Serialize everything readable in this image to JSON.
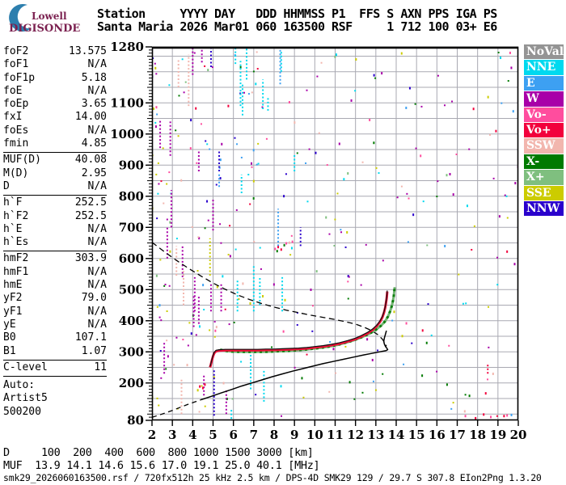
{
  "logo": {
    "line1": "Lowell",
    "line2": "DIGISONDE",
    "crescent_color": "#2d7fae"
  },
  "header": {
    "line1": "Station     YYYY DAY   DDD HHMMSS P1  FFS S AXN PPS IGA PS",
    "line2": "Santa Maria 2026 Mar01 060 163500 RSF     1 712 100 03+ E6"
  },
  "params": {
    "groups": [
      {
        "rows": [
          {
            "label": "foF2",
            "value": "13.575"
          },
          {
            "label": "foF1",
            "value": "N/A"
          },
          {
            "label": "foF1p",
            "value": "5.18"
          },
          {
            "label": "foE",
            "value": "N/A"
          },
          {
            "label": "foEp",
            "value": "3.65"
          },
          {
            "label": "fxI",
            "value": "14.00"
          },
          {
            "label": "foEs",
            "value": "N/A"
          },
          {
            "label": "fmin",
            "value": "4.85"
          }
        ]
      },
      {
        "rows": [
          {
            "label": "MUF(D)",
            "value": "40.08"
          },
          {
            "label": "M(D)",
            "value": "2.95"
          },
          {
            "label": "D",
            "value": "N/A"
          }
        ]
      },
      {
        "rows": [
          {
            "label": "h`F",
            "value": "252.5"
          },
          {
            "label": "h`F2",
            "value": "252.5"
          },
          {
            "label": "h`E",
            "value": "N/A"
          },
          {
            "label": "h`Es",
            "value": "N/A"
          }
        ]
      },
      {
        "rows": [
          {
            "label": "hmF2",
            "value": "303.9"
          },
          {
            "label": "hmF1",
            "value": "N/A"
          },
          {
            "label": "hmE",
            "value": "N/A"
          },
          {
            "label": "yF2",
            "value": "79.0"
          },
          {
            "label": "yF1",
            "value": "N/A"
          },
          {
            "label": "yE",
            "value": "N/A"
          },
          {
            "label": "B0",
            "value": "107.1"
          },
          {
            "label": "B1",
            "value": "1.07"
          }
        ]
      },
      {
        "rows": [
          {
            "label": "C-level",
            "value": "11"
          }
        ]
      }
    ],
    "auto_lines": [
      "Auto:",
      "Artist5",
      "500200"
    ]
  },
  "legend": {
    "items": [
      {
        "label": "NoVal",
        "color": "#949494"
      },
      {
        "label": "NNE",
        "color": "#00d9ef"
      },
      {
        "label": "E",
        "color": "#3da0f2"
      },
      {
        "label": "W",
        "color": "#a800a8"
      },
      {
        "label": "Vo-",
        "color": "#ff4d9e"
      },
      {
        "label": "Vo+",
        "color": "#f2003c"
      },
      {
        "label": "SSW",
        "color": "#f2b6ae"
      },
      {
        "label": "X-",
        "color": "#007a00"
      },
      {
        "label": "X+",
        "color": "#7fbf7f"
      },
      {
        "label": "SSE",
        "color": "#cccc00"
      },
      {
        "label": "NNW",
        "color": "#2a00cc"
      }
    ]
  },
  "chart_data": {
    "type": "scatter",
    "x_range": [
      2,
      20
    ],
    "y_range": [
      80,
      1280
    ],
    "x_ticks": [
      2,
      3,
      4,
      5,
      6,
      7,
      8,
      9,
      10,
      11,
      12,
      13,
      14,
      15,
      16,
      17,
      18,
      19,
      20
    ],
    "y_tick_labels": [
      80,
      200,
      300,
      400,
      500,
      600,
      700,
      800,
      900,
      1000,
      1100,
      1280
    ],
    "grid": {
      "x_step": 1,
      "y_step": 50,
      "color": "#a9a9b2"
    },
    "palette": {
      "NoVal": "#949494",
      "NNE": "#00d9ef",
      "E": "#3da0f2",
      "W": "#a800a8",
      "Vo-": "#ff4d9e",
      "Vo+": "#f2003c",
      "SSW": "#f2b6ae",
      "X-": "#007a00",
      "X+": "#7fbf7f",
      "SSE": "#cccc00",
      "NNW": "#2a00cc"
    },
    "trace_colors": {
      "o_trace": "#ee1038",
      "o_fit": "#101010",
      "x_trace_light": "#74b674",
      "x_trace_dark": "#0f7d0f",
      "profile": "#000000"
    },
    "traces": {
      "o_trace": [
        [
          4.85,
          250
        ],
        [
          4.88,
          256
        ],
        [
          4.91,
          264
        ],
        [
          4.95,
          274
        ],
        [
          5.0,
          286
        ],
        [
          5.06,
          296
        ],
        [
          5.15,
          302
        ],
        [
          5.3,
          304
        ],
        [
          5.6,
          305
        ],
        [
          6.0,
          305
        ],
        [
          6.4,
          305
        ],
        [
          6.8,
          305
        ],
        [
          7.2,
          305
        ],
        [
          7.6,
          306
        ],
        [
          8.0,
          306
        ],
        [
          8.4,
          307
        ],
        [
          8.8,
          308
        ],
        [
          9.2,
          309
        ],
        [
          9.6,
          311
        ],
        [
          10.0,
          314
        ],
        [
          10.4,
          317
        ],
        [
          10.8,
          321
        ],
        [
          11.2,
          326
        ],
        [
          11.6,
          333
        ],
        [
          12.0,
          341
        ],
        [
          12.3,
          350
        ],
        [
          12.6,
          360
        ],
        [
          12.85,
          371
        ],
        [
          13.05,
          383
        ],
        [
          13.2,
          396
        ],
        [
          13.32,
          411
        ],
        [
          13.4,
          426
        ],
        [
          13.46,
          442
        ],
        [
          13.5,
          458
        ],
        [
          13.53,
          472
        ],
        [
          13.55,
          486
        ],
        [
          13.56,
          494
        ]
      ],
      "x_trace": [
        [
          5.35,
          307
        ],
        [
          5.6,
          303
        ],
        [
          5.9,
          301
        ],
        [
          6.3,
          300
        ],
        [
          6.7,
          300
        ],
        [
          7.1,
          300
        ],
        [
          7.5,
          300
        ],
        [
          7.9,
          301
        ],
        [
          8.3,
          302
        ],
        [
          8.7,
          303
        ],
        [
          9.1,
          305
        ],
        [
          9.5,
          307
        ],
        [
          9.9,
          310
        ],
        [
          10.3,
          313
        ],
        [
          10.7,
          317
        ],
        [
          11.1,
          322
        ],
        [
          11.5,
          329
        ],
        [
          11.9,
          337
        ],
        [
          12.3,
          347
        ],
        [
          12.7,
          359
        ],
        [
          13.0,
          371
        ],
        [
          13.25,
          384
        ],
        [
          13.45,
          398
        ],
        [
          13.6,
          414
        ],
        [
          13.7,
          430
        ],
        [
          13.78,
          447
        ],
        [
          13.84,
          464
        ],
        [
          13.88,
          480
        ],
        [
          13.91,
          497
        ],
        [
          13.93,
          508
        ]
      ],
      "profile_dashed": [
        [
          2.0,
          90
        ],
        [
          2.35,
          97
        ],
        [
          2.7,
          105
        ],
        [
          3.05,
          113
        ],
        [
          3.4,
          122
        ],
        [
          3.75,
          131
        ],
        [
          4.1,
          139
        ],
        [
          4.4,
          146
        ]
      ],
      "profile_solid": [
        [
          4.4,
          146
        ],
        [
          4.9,
          157
        ],
        [
          5.4,
          168
        ],
        [
          5.9,
          179
        ],
        [
          6.4,
          190
        ],
        [
          6.9,
          200
        ],
        [
          7.4,
          210
        ],
        [
          7.9,
          220
        ],
        [
          8.4,
          229
        ],
        [
          8.9,
          238
        ],
        [
          9.4,
          246
        ],
        [
          9.9,
          254
        ],
        [
          10.4,
          262
        ],
        [
          10.9,
          269
        ],
        [
          11.4,
          276
        ],
        [
          11.9,
          283
        ],
        [
          12.4,
          290
        ],
        [
          12.8,
          295
        ],
        [
          13.1,
          299
        ],
        [
          13.35,
          302
        ],
        [
          13.5,
          304
        ],
        [
          13.58,
          307
        ],
        [
          13.55,
          311
        ],
        [
          13.48,
          317
        ],
        [
          13.42,
          325
        ],
        [
          13.39,
          334
        ],
        [
          13.42,
          345
        ],
        [
          13.47,
          357
        ],
        [
          13.52,
          368
        ]
      ],
      "muf_dashed": [
        [
          2.0,
          652
        ],
        [
          2.6,
          622
        ],
        [
          3.2,
          594
        ],
        [
          3.8,
          568
        ],
        [
          4.4,
          544
        ],
        [
          5.0,
          521
        ],
        [
          5.6,
          501
        ],
        [
          6.2,
          483
        ],
        [
          6.8,
          468
        ],
        [
          7.4,
          455
        ],
        [
          8.0,
          444
        ],
        [
          8.6,
          434
        ],
        [
          9.2,
          426
        ],
        [
          9.8,
          418
        ],
        [
          10.4,
          411
        ],
        [
          11.0,
          404
        ],
        [
          11.5,
          397
        ],
        [
          12.0,
          389
        ],
        [
          12.4,
          380
        ],
        [
          12.8,
          368
        ],
        [
          13.1,
          355
        ],
        [
          13.3,
          342
        ],
        [
          13.45,
          329
        ],
        [
          13.52,
          318
        ]
      ]
    },
    "streaks": [
      {
        "f": 2.4,
        "h1": 955,
        "h2": 1045,
        "c": "W"
      },
      {
        "f": 2.6,
        "h1": 230,
        "h2": 330,
        "c": "W"
      },
      {
        "f": 2.75,
        "h1": 600,
        "h2": 700,
        "c": "W"
      },
      {
        "f": 2.9,
        "h1": 930,
        "h2": 1040,
        "c": "W"
      },
      {
        "f": 2.95,
        "h1": 700,
        "h2": 820,
        "c": "W"
      },
      {
        "f": 3.2,
        "h1": 545,
        "h2": 640,
        "c": "SSW"
      },
      {
        "f": 3.3,
        "h1": 1150,
        "h2": 1240,
        "c": "SSW"
      },
      {
        "f": 3.45,
        "h1": 100,
        "h2": 215,
        "c": "SSW"
      },
      {
        "f": 3.5,
        "h1": 540,
        "h2": 640,
        "c": "W"
      },
      {
        "f": 3.55,
        "h1": 450,
        "h2": 560,
        "c": "SSW"
      },
      {
        "f": 3.8,
        "h1": 1090,
        "h2": 1255,
        "c": "SSW"
      },
      {
        "f": 4.0,
        "h1": 1190,
        "h2": 1278,
        "c": "W"
      },
      {
        "f": 4.05,
        "h1": 380,
        "h2": 480,
        "c": "W"
      },
      {
        "f": 4.1,
        "h1": 430,
        "h2": 540,
        "c": "W"
      },
      {
        "f": 4.3,
        "h1": 880,
        "h2": 950,
        "c": "W"
      },
      {
        "f": 4.3,
        "h1": 390,
        "h2": 480,
        "c": "W"
      },
      {
        "f": 4.45,
        "h1": 1230,
        "h2": 1278,
        "c": "W"
      },
      {
        "f": 4.55,
        "h1": 160,
        "h2": 230,
        "c": "W"
      },
      {
        "f": 4.85,
        "h1": 545,
        "h2": 665,
        "c": "SSE"
      },
      {
        "f": 4.9,
        "h1": 1215,
        "h2": 1278,
        "c": "NNW"
      },
      {
        "f": 4.9,
        "h1": 430,
        "h2": 520,
        "c": "W"
      },
      {
        "f": 5.0,
        "h1": 690,
        "h2": 790,
        "c": "W"
      },
      {
        "f": 5.05,
        "h1": 95,
        "h2": 245,
        "c": "NNW"
      },
      {
        "f": 5.3,
        "h1": 830,
        "h2": 875,
        "c": "E"
      },
      {
        "f": 5.3,
        "h1": 880,
        "h2": 945,
        "c": "NNW"
      },
      {
        "f": 5.4,
        "h1": 430,
        "h2": 520,
        "c": "W"
      },
      {
        "f": 5.65,
        "h1": 100,
        "h2": 180,
        "c": "W"
      },
      {
        "f": 5.9,
        "h1": 85,
        "h2": 115,
        "c": "NNE"
      },
      {
        "f": 6.1,
        "h1": 1225,
        "h2": 1278,
        "c": "NNE"
      },
      {
        "f": 6.2,
        "h1": 430,
        "h2": 530,
        "c": "NNE"
      },
      {
        "f": 6.35,
        "h1": 1090,
        "h2": 1235,
        "c": "NNE"
      },
      {
        "f": 6.45,
        "h1": 1060,
        "h2": 1160,
        "c": "NNE"
      },
      {
        "f": 6.65,
        "h1": 1175,
        "h2": 1275,
        "c": "NNE"
      },
      {
        "f": 6.85,
        "h1": 180,
        "h2": 290,
        "c": "NNE"
      },
      {
        "f": 7.0,
        "h1": 430,
        "h2": 575,
        "c": "NNE"
      },
      {
        "f": 7.3,
        "h1": 450,
        "h2": 540,
        "c": "NNE"
      },
      {
        "f": 7.45,
        "h1": 1080,
        "h2": 1175,
        "c": "NNE"
      },
      {
        "f": 7.5,
        "h1": 140,
        "h2": 245,
        "c": "NNE"
      },
      {
        "f": 7.7,
        "h1": 1075,
        "h2": 1120,
        "c": "NNE"
      },
      {
        "f": 8.2,
        "h1": 640,
        "h2": 760,
        "c": "E"
      },
      {
        "f": 8.3,
        "h1": 1160,
        "h2": 1270,
        "c": "E"
      },
      {
        "f": 8.35,
        "h1": 1200,
        "h2": 1270,
        "c": "NNE"
      },
      {
        "f": 8.4,
        "h1": 430,
        "h2": 540,
        "c": "NNE"
      },
      {
        "f": 9.0,
        "h1": 880,
        "h2": 935,
        "c": "NNE"
      },
      {
        "f": 9.3,
        "h1": 640,
        "h2": 700,
        "c": "NNW"
      },
      {
        "f": 6.4,
        "h1": 810,
        "h2": 870,
        "c": "NNE"
      },
      {
        "f": 18.5,
        "h1": 230,
        "h2": 262,
        "c": "Vo+"
      }
    ],
    "extra_dots": [
      [
        8.05,
        632,
        "Vo-"
      ],
      [
        8.2,
        638,
        "Vo+"
      ],
      [
        8.35,
        630,
        "Vo+"
      ],
      [
        8.5,
        644,
        "X-"
      ],
      [
        8.6,
        650,
        "Vo-"
      ],
      [
        8.75,
        652,
        "SSW"
      ],
      [
        8.9,
        655,
        "Vo-"
      ],
      [
        8.15,
        625,
        "X-"
      ],
      [
        17.4,
        95,
        "Vo-"
      ],
      [
        17.9,
        88,
        "Vo+"
      ],
      [
        18.3,
        100,
        "Vo+"
      ],
      [
        18.65,
        92,
        "Vo-"
      ],
      [
        19.3,
        95,
        "Vo+"
      ],
      [
        19.45,
        97,
        "Vo-"
      ],
      [
        18.4,
        168,
        "Vo+"
      ],
      [
        15.3,
        370,
        "Vo+"
      ],
      [
        14.5,
        393,
        "Vo-"
      ],
      [
        16.5,
        196,
        "X-"
      ],
      [
        17.6,
        160,
        "X-"
      ],
      [
        15.5,
        330,
        "X-"
      ],
      [
        13.9,
        430,
        "SSE"
      ],
      [
        14.3,
        352,
        "SSE"
      ],
      [
        4.35,
        190,
        "Vo+"
      ],
      [
        4.5,
        185,
        "Vo+"
      ],
      [
        4.25,
        178,
        "SSE"
      ],
      [
        4.6,
        196,
        "Vo+"
      ],
      [
        19.6,
        1262,
        "Vo-"
      ],
      [
        17.8,
        1082,
        "Vo+"
      ]
    ],
    "noise": {
      "seed": 20260301,
      "count": 300,
      "low_freq_bias": 1.45,
      "color_weights": {
        "W": 0.26,
        "NNE": 0.13,
        "SSE": 0.16,
        "SSW": 0.08,
        "E": 0.07,
        "NNW": 0.07,
        "X-": 0.08,
        "X+": 0.05,
        "Vo-": 0.06,
        "Vo+": 0.04
      }
    }
  },
  "bottom": {
    "d_row": {
      "label": "D",
      "values": [
        "100",
        "200",
        "400",
        "600",
        "800",
        "1000",
        "1500",
        "3000"
      ],
      "unit": "[km]"
    },
    "muf_row": {
      "label": "MUF",
      "values": [
        "13.9",
        "14.1",
        "14.6",
        "15.6",
        "17.0",
        "19.1",
        "25.0",
        "40.1"
      ],
      "unit": "[MHz]"
    },
    "footer": "smk29_2026060163500.rsf / 720fx512h 25 kHz 2.5 km / DPS-4D SMK29 129 / 29.7 S 307.8 EIon2Png 1.3.20"
  }
}
